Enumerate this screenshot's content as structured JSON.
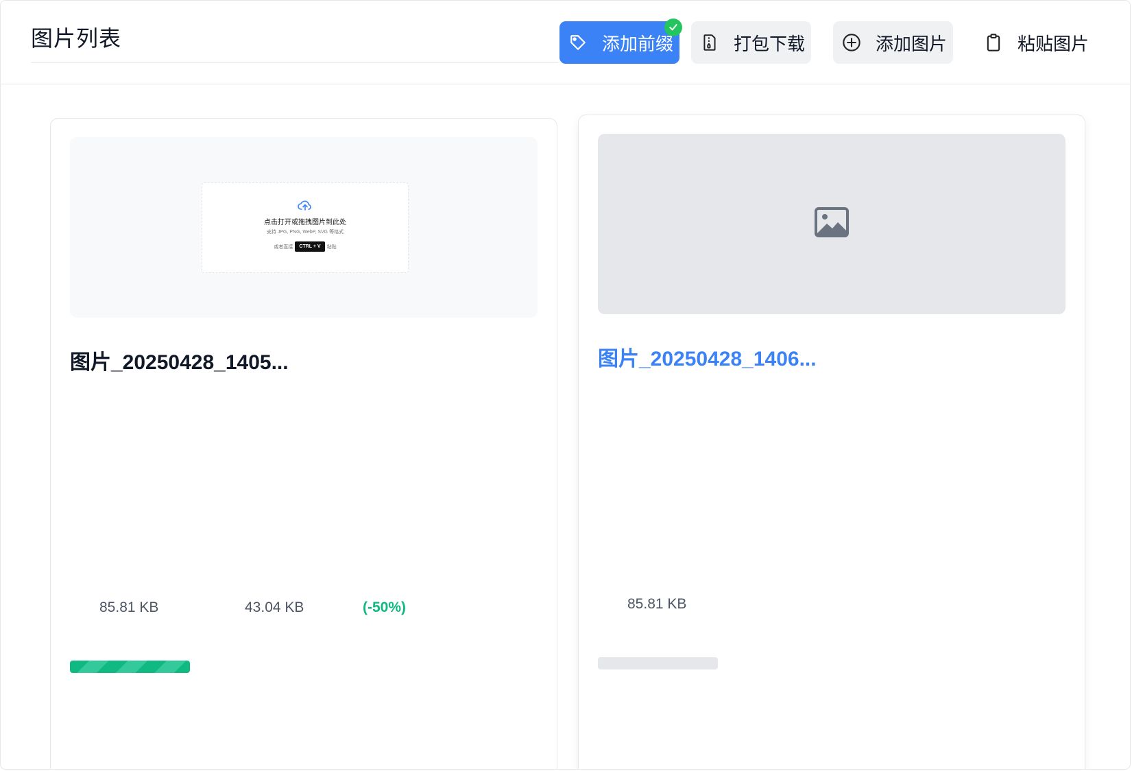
{
  "header": {
    "title": "图片列表",
    "buttons": {
      "add_prefix": "添加前缀",
      "zip_download": "打包下载",
      "add_image": "添加图片",
      "paste_image": "粘贴图片"
    }
  },
  "cards": [
    {
      "filename": "图片_20250428_1405...",
      "original_size": "85.81 KB",
      "compressed_size": "43.04 KB",
      "saving": "(-50%)",
      "progress": 1.0,
      "thumbnail": {
        "main_text": "点击打开或拖拽图片到此处",
        "sub_text": "支持 JPG, PNG, WebP, SVG 等格式",
        "paste_prefix": "或者直接",
        "shortcut": "CTRL + V",
        "paste_suffix": "粘贴"
      }
    },
    {
      "filename": "图片_20250428_1406...",
      "original_size": "85.81 KB",
      "progress": 0.0
    }
  ],
  "colors": {
    "primary": "#3b82f6",
    "success": "#10b981",
    "badge": "#22c55e"
  }
}
